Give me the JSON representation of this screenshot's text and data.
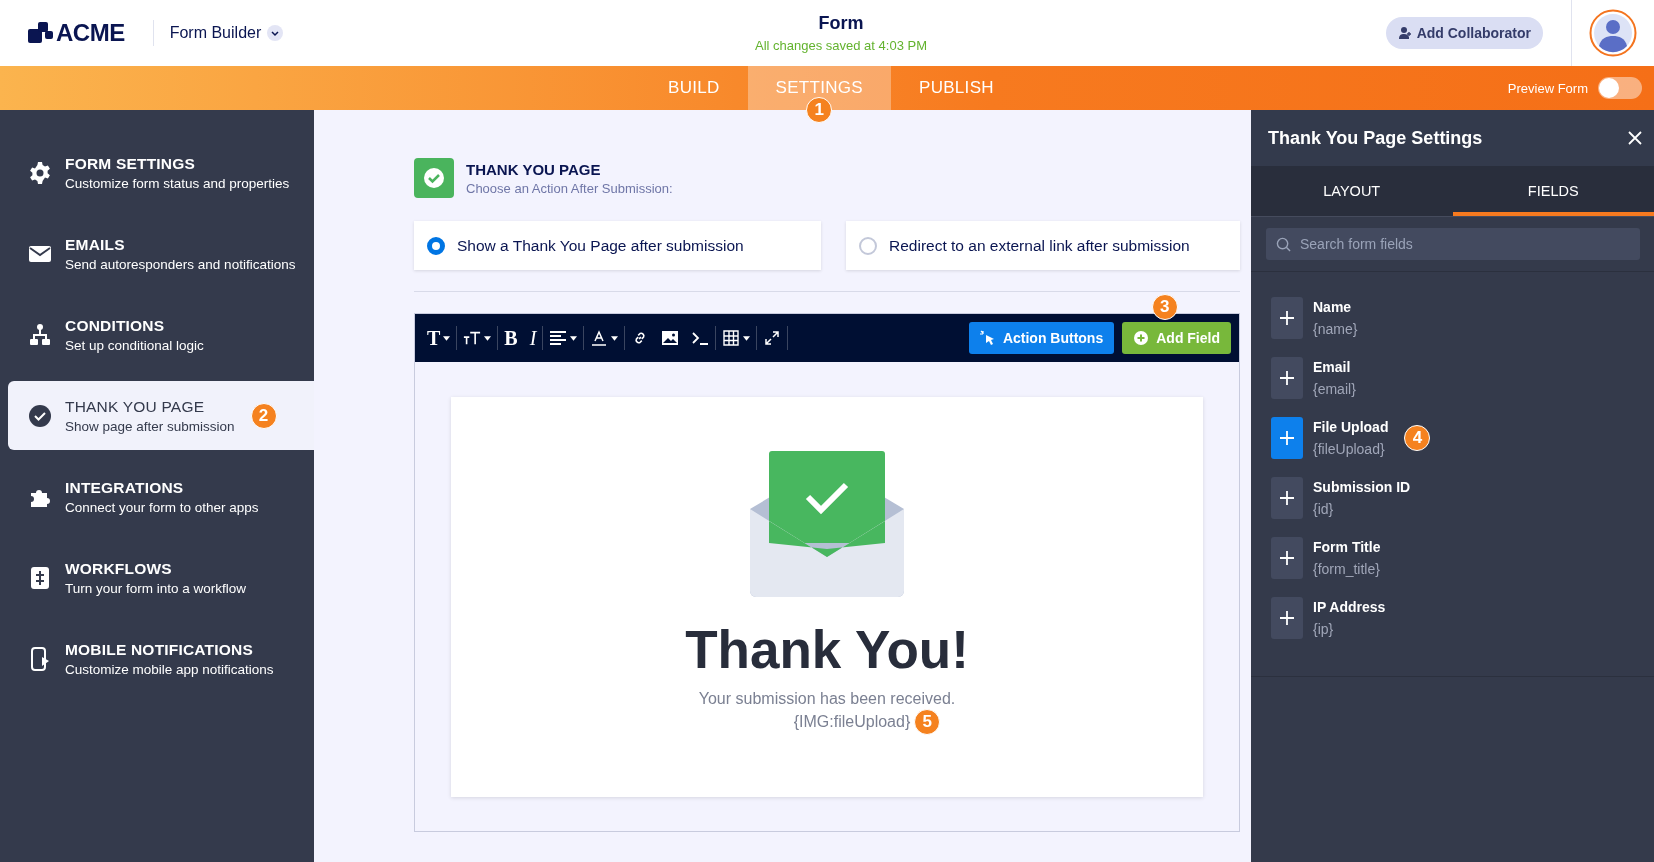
{
  "header": {
    "logo": "ACME",
    "app_menu": "Form Builder",
    "title": "Form",
    "save_status": "All changes saved at 4:03 PM",
    "collaborator_button": "Add Collaborator"
  },
  "nav": {
    "tabs": [
      {
        "label": "BUILD",
        "selected": false
      },
      {
        "label": "SETTINGS",
        "selected": true,
        "callout": "1"
      },
      {
        "label": "PUBLISH",
        "selected": false
      }
    ],
    "preview": {
      "label": "Preview Form",
      "on": false
    }
  },
  "sidebar": {
    "items": [
      {
        "kind": "gear",
        "title": "FORM SETTINGS",
        "subtitle": "Customize form status and properties",
        "selected": false
      },
      {
        "kind": "mail",
        "title": "EMAILS",
        "subtitle": "Send autoresponders and notifications",
        "selected": false
      },
      {
        "kind": "tree",
        "title": "CONDITIONS",
        "subtitle": "Set up conditional logic",
        "selected": false
      },
      {
        "kind": "check",
        "title": "THANK YOU PAGE",
        "subtitle": "Show page after submission",
        "selected": true,
        "callout": "2"
      },
      {
        "kind": "puzzle",
        "title": "INTEGRATIONS",
        "subtitle": "Connect your form to other apps",
        "selected": false
      },
      {
        "kind": "flow",
        "title": "WORKFLOWS",
        "subtitle": "Turn your form into a workflow",
        "selected": false
      },
      {
        "kind": "phone",
        "title": "MOBILE NOTIFICATIONS",
        "subtitle": "Customize mobile app notifications",
        "selected": false
      }
    ]
  },
  "section": {
    "title": "THANK YOU PAGE",
    "subtitle": "Choose an Action After Submission:"
  },
  "options": [
    {
      "label": "Show a Thank You Page after submission",
      "selected": true
    },
    {
      "label": "Redirect to an external link after submission",
      "selected": false
    }
  ],
  "toolbar": {
    "tools": [
      {
        "kind": "glyph",
        "text": "T",
        "dropdown": true
      },
      {
        "kind": "size",
        "dropdown": true
      },
      {
        "kind": "glyph",
        "text": "B",
        "dropdown": false
      },
      {
        "kind": "italic",
        "text": "I",
        "dropdown": false
      },
      {
        "kind": "align",
        "dropdown": true
      },
      {
        "kind": "color",
        "dropdown": true
      },
      {
        "kind": "link",
        "dropdown": false
      },
      {
        "kind": "image",
        "dropdown": false
      },
      {
        "kind": "code",
        "dropdown": false
      },
      {
        "kind": "table",
        "dropdown": true
      },
      {
        "kind": "expand",
        "dropdown": false
      }
    ],
    "action_buttons": "Action Buttons",
    "add_field": "Add Field",
    "add_field_callout": "3"
  },
  "preview": {
    "heading": "Thank You!",
    "message": "Your submission has been received.",
    "field_tag": "{IMG:fileUpload}",
    "callout": "5"
  },
  "panel": {
    "title": "Thank You Page Settings",
    "tabs": [
      {
        "label": "LAYOUT",
        "selected": false
      },
      {
        "label": "FIELDS",
        "selected": true
      }
    ],
    "search": {
      "placeholder": "Search form fields"
    },
    "fields": [
      {
        "name": "Name",
        "tag": "{name}",
        "selected": false
      },
      {
        "name": "Email",
        "tag": "{email}",
        "selected": false
      },
      {
        "name": "File Upload",
        "tag": "{fileUpload}",
        "selected": true,
        "callout": "4"
      },
      {
        "name": "Submission ID",
        "tag": "{id}",
        "selected": false
      },
      {
        "name": "Form Title",
        "tag": "{form_title}",
        "selected": false
      },
      {
        "name": "IP Address",
        "tag": "{ip}",
        "selected": false
      }
    ]
  }
}
